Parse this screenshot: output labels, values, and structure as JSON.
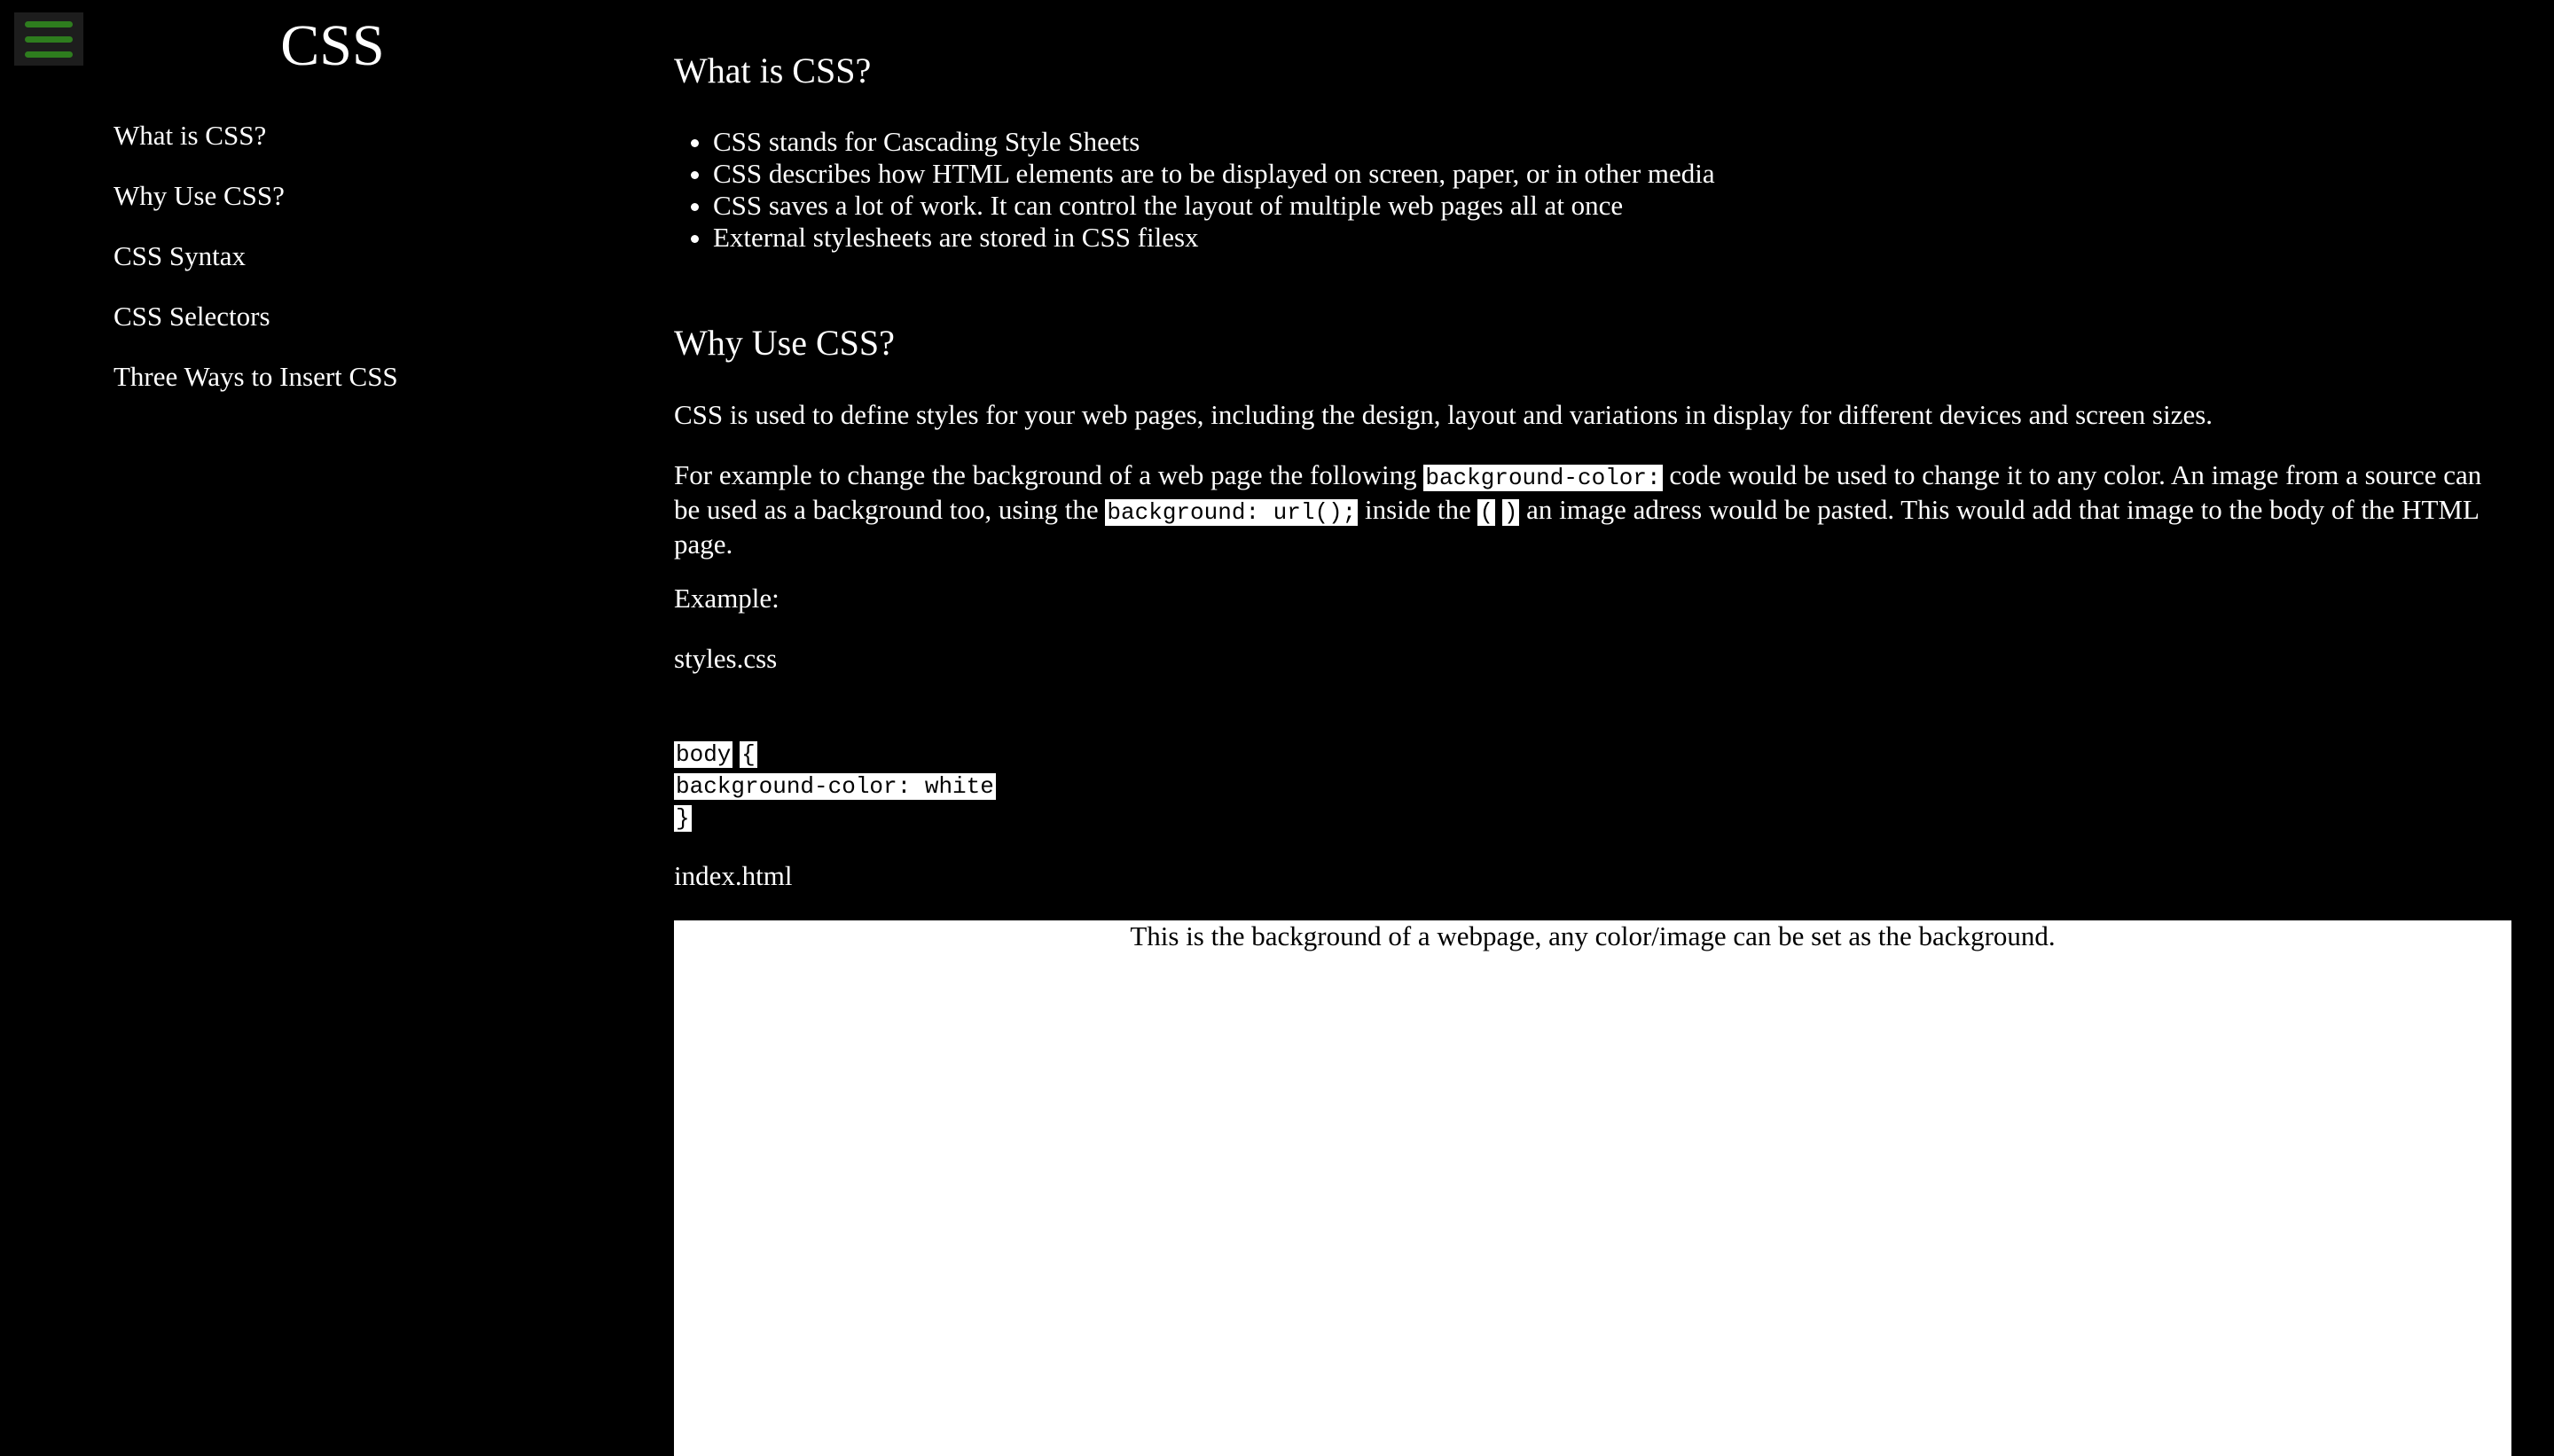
{
  "menu": {
    "icon": "hamburger-menu-icon"
  },
  "sidebar": {
    "title": "CSS",
    "items": [
      {
        "label": "What is CSS?"
      },
      {
        "label": "Why Use CSS?"
      },
      {
        "label": "CSS Syntax"
      },
      {
        "label": "CSS Selectors"
      },
      {
        "label": "Three Ways to Insert CSS"
      }
    ]
  },
  "what_is": {
    "heading": "What is CSS?",
    "bullets": [
      "CSS stands for Cascading Style Sheets",
      "CSS describes how HTML elements are to be displayed on screen, paper, or in other media",
      "CSS saves a lot of work. It can control the layout of multiple web pages all at once",
      "External stylesheets are stored in CSS filesx"
    ]
  },
  "why_use": {
    "heading": "Why Use CSS?",
    "intro": "CSS is used to define styles for your web pages, including the design, layout and variations in display for different devices and screen sizes.",
    "para2": {
      "t1": "For example to change the background of a web page the following ",
      "c1": "background-color:",
      "t2": " code would be used to change it to any color. An image from a source can be used as a background too, using the ",
      "c2": "background: url();",
      "t3": " inside the ",
      "c3": "(",
      "t4": " ",
      "c4": ")",
      "t5": " an image adress would be pasted. This would add that image to the body of the HTML page."
    },
    "example_label": "Example:",
    "css_file": "styles.css",
    "code_lines": {
      "l1a": "body",
      "l1b": "{",
      "l2": "background-color: white",
      "l3": "}"
    },
    "html_file": "index.html",
    "preview_text": "This is the background of a webpage, any color/image can be set as the background."
  },
  "colors": {
    "background": "#000000",
    "text": "#ffffff",
    "menu_accent": "#2e7d1e"
  }
}
